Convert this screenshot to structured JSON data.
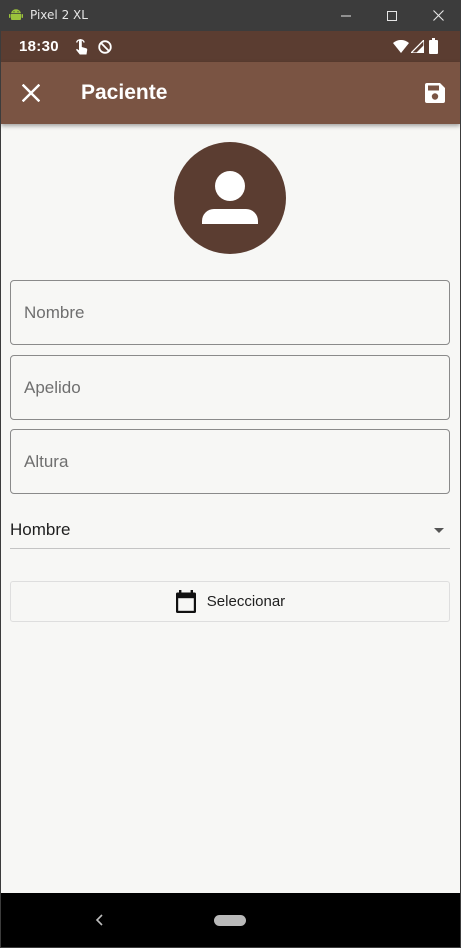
{
  "window": {
    "title": "Pixel 2 XL",
    "icons": [
      "android-icon",
      "minimize-icon",
      "maximize-icon",
      "close-window-icon"
    ]
  },
  "status_bar": {
    "time": "18:30",
    "icons": [
      "gesture-icon",
      "sync-off-icon",
      "wifi-icon",
      "signal-icon",
      "battery-icon"
    ]
  },
  "app_bar": {
    "title": "Paciente",
    "leading_icon": "close-icon",
    "trailing_icon": "save-icon"
  },
  "form": {
    "avatar_icon": "person-icon",
    "nombre": {
      "value": "",
      "placeholder": "Nombre"
    },
    "apellido": {
      "value": "",
      "placeholder": "Apelido"
    },
    "altura": {
      "value": "",
      "placeholder": "Altura"
    },
    "sexo": {
      "selected": "Hombre"
    },
    "date_button": {
      "label": "Seleccionar",
      "icon": "calendar-icon"
    }
  },
  "nav_bar": {
    "icons": [
      "back-icon",
      "home-pill"
    ]
  },
  "colors": {
    "status_bar": "#5b3d31",
    "app_bar": "#7a5443",
    "avatar": "#5b3d31",
    "background": "#f7f7f5"
  }
}
